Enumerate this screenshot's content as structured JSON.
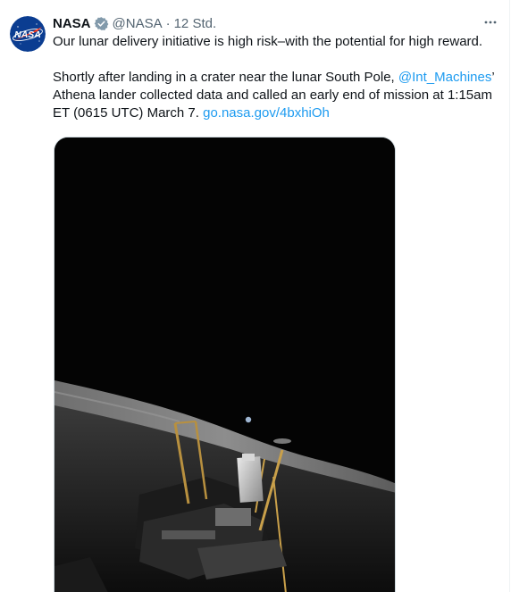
{
  "tweet": {
    "author_name": "NASA",
    "author_handle": "@NASA",
    "separator": "·",
    "timestamp": "12 Std.",
    "verified": true,
    "avatar_text": "NASA",
    "text_line1": "Our lunar delivery initiative is high risk–with the potential for high reward.",
    "text2_part1": "Shortly after landing in a crater near the lunar South Pole, ",
    "mention": "@Int_Machines",
    "text2_part2": "’ Athena lander collected data and called an early end of mission at 1:15am ET (0615 UTC) March 7. ",
    "link": "go.nasa.gov/4bxhiOh",
    "more_icon": "more-dots-icon",
    "media_alt_subject": "Athena lander on the lunar surface with Earth in the sky"
  },
  "colors": {
    "link": "#1d9bf0",
    "secondary_text": "#536471",
    "verified_badge": "#829aab",
    "nasa_blue": "#0b3d91",
    "nasa_red": "#fc3d21"
  }
}
